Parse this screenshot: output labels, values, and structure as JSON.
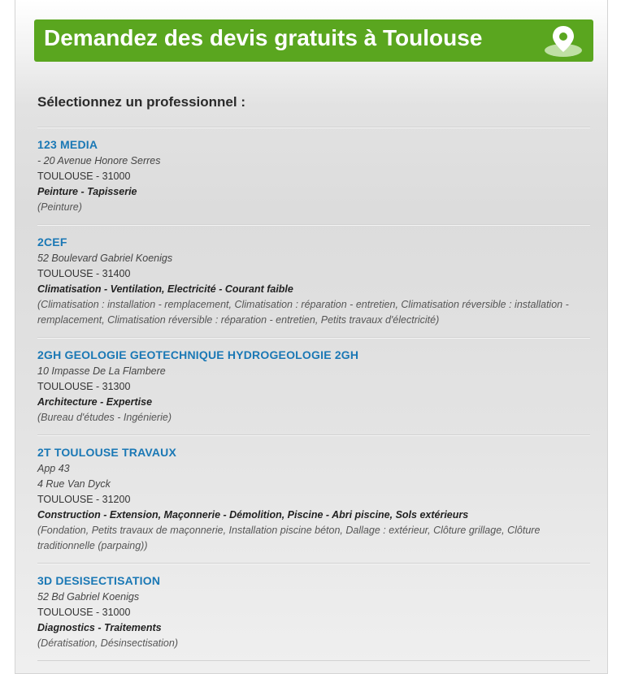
{
  "banner": {
    "title": "Demandez des devis gratuits à Toulouse",
    "icon": "map-pin-icon",
    "color": "#5aa61f"
  },
  "section_title": "Sélectionnez un professionnel :",
  "colors": {
    "name_link": "#1a78b5",
    "text": "#333333"
  },
  "professionals": [
    {
      "name": "123 MEDIA",
      "address_lines": [
        "- 20 Avenue Honore Serres"
      ],
      "city": "TOULOUSE - 31000",
      "categories": "Peinture - Tapisserie",
      "subcategories": "(Peinture)"
    },
    {
      "name": "2CEF",
      "address_lines": [
        "52 Boulevard Gabriel Koenigs"
      ],
      "city": "TOULOUSE - 31400",
      "categories": "Climatisation - Ventilation, Electricité - Courant faible",
      "subcategories": "(Climatisation : installation - remplacement, Climatisation : réparation - entretien, Climatisation réversible : installation - remplacement, Climatisation réversible : réparation - entretien, Petits travaux d'électricité)"
    },
    {
      "name": "2GH GEOLOGIE GEOTECHNIQUE HYDROGEOLOGIE 2GH",
      "address_lines": [
        "10 Impasse De La Flambere"
      ],
      "city": "TOULOUSE - 31300",
      "categories": "Architecture - Expertise",
      "subcategories": "(Bureau d'études - Ingénierie)"
    },
    {
      "name": "2T TOULOUSE TRAVAUX",
      "address_lines": [
        "App 43",
        "4 Rue Van Dyck"
      ],
      "city": "TOULOUSE - 31200",
      "categories": "Construction - Extension, Maçonnerie - Démolition, Piscine - Abri piscine, Sols extérieurs",
      "subcategories": "(Fondation, Petits travaux de maçonnerie, Installation piscine béton, Dallage : extérieur, Clôture grillage, Clôture traditionnelle (parpaing))"
    },
    {
      "name": "3D DESISECTISATION",
      "address_lines": [
        "52 Bd Gabriel Koenigs"
      ],
      "city": "TOULOUSE - 31000",
      "categories": "Diagnostics - Traitements",
      "subcategories": "(Dératisation, Désinsectisation)"
    }
  ]
}
